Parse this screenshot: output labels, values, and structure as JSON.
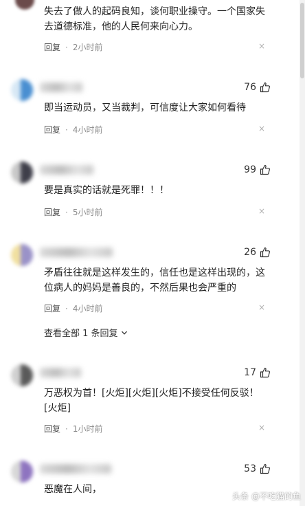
{
  "comments": [
    {
      "text": "失去了做人的起码良知，谈何职业操守。一个国家失去道德标准，他的人民何来向心力。",
      "reply": "回复",
      "time": "2小时前",
      "close": "×"
    },
    {
      "likes": "76",
      "text": "即当运动员，又当裁判，可信度让大家如何看待",
      "reply": "回复",
      "time": "4小时前",
      "close": "×",
      "avatar_colors": [
        "#d7e8f5",
        "#4a8fd1"
      ]
    },
    {
      "likes": "99",
      "text": "要是真实的话就是死罪！！！",
      "reply": "回复",
      "time": "5小时前",
      "close": "×",
      "avatar_colors": [
        "#c8c8c8",
        "#3f3f4a"
      ]
    },
    {
      "likes": "26",
      "text": "矛盾往往就是这样发生的，信任也是这样出现的，这位病人的妈妈是善良的，不然后果也会严重的",
      "reply": "回复",
      "time": "4小时前",
      "close": "×",
      "view_replies": "查看全部 1 条回复",
      "avatar_colors": [
        "#f1e0a0",
        "#9a92c8"
      ]
    },
    {
      "likes": "17",
      "text": "万恶权为首！[火炬][火炬][火炬]不接受任何反驳！[火炬]",
      "reply": "回复",
      "time": "1小时前",
      "close": "×",
      "avatar_colors": [
        "#d0d0d0",
        "#5a5a5a"
      ]
    },
    {
      "likes": "53",
      "text": "恶魔在人间，",
      "avatar_colors": [
        "#d8d8d8",
        "#8e74c0"
      ]
    }
  ],
  "watermark": "头条 @不吃猫的鱼",
  "icons": {
    "like": "thumbs-up-icon",
    "chevron": "chevron-down-icon"
  }
}
